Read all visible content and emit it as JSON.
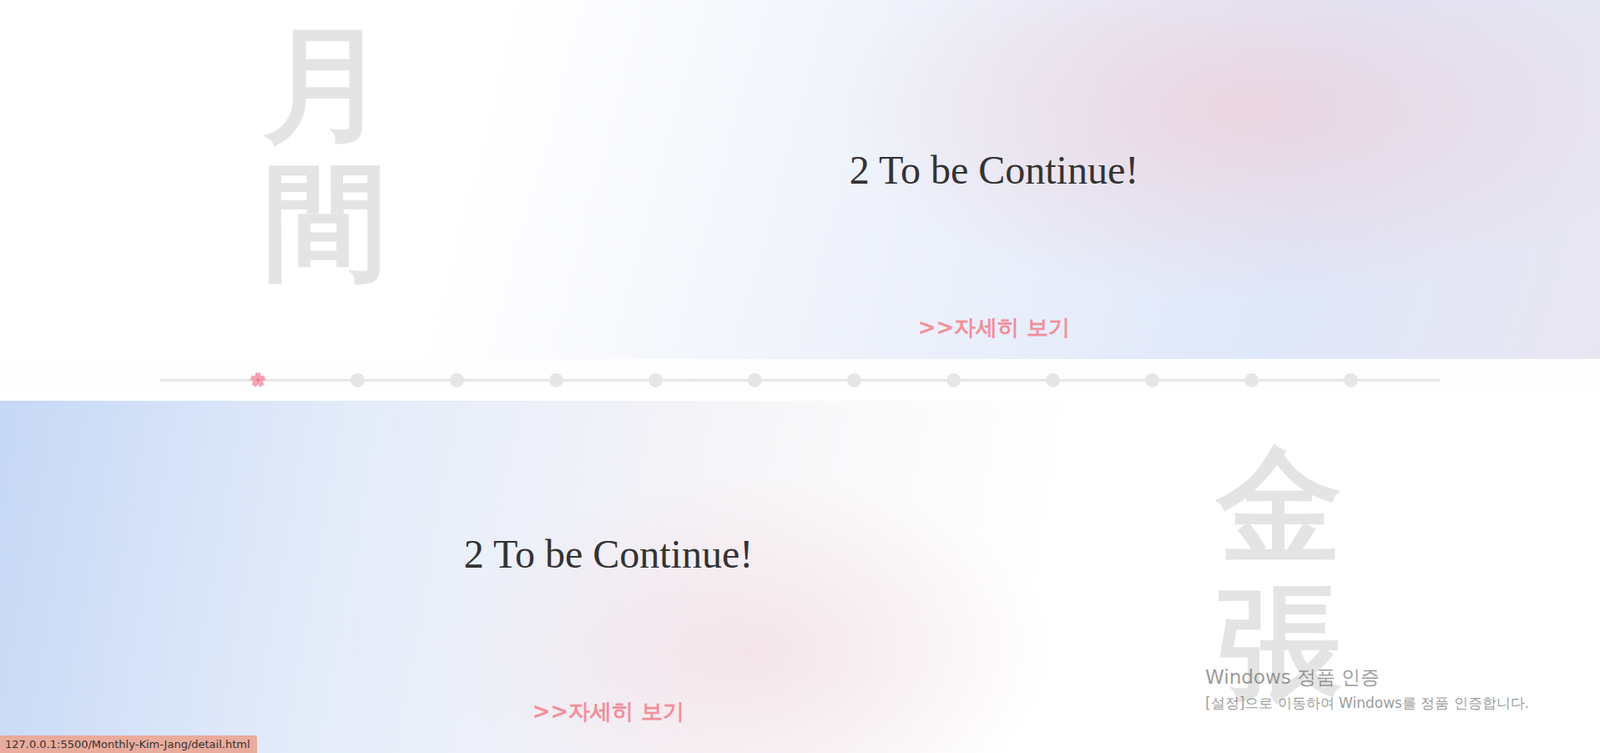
{
  "sections": [
    {
      "kanji": "月間",
      "title": "2 To be Continue!",
      "link": ">>자세히 보기"
    },
    {
      "kanji": "金張",
      "title": "2 To be Continue!",
      "link": ">>자세히 보기"
    }
  ],
  "timeline": [
    {
      "selected": true
    },
    {
      "selected": false
    },
    {
      "selected": false
    },
    {
      "selected": false
    },
    {
      "selected": false
    },
    {
      "selected": false
    },
    {
      "selected": false
    },
    {
      "selected": false
    },
    {
      "selected": false
    },
    {
      "selected": false
    },
    {
      "selected": false
    },
    {
      "selected": false
    }
  ],
  "watermark": {
    "title": "Windows 정품 인증",
    "subtitle": "[설정]으로 이동하여 Windows를 정품 인증합니다."
  },
  "status_bar": "127.0.0.1:5500/Monthly-Kim-Jang/detail.html"
}
